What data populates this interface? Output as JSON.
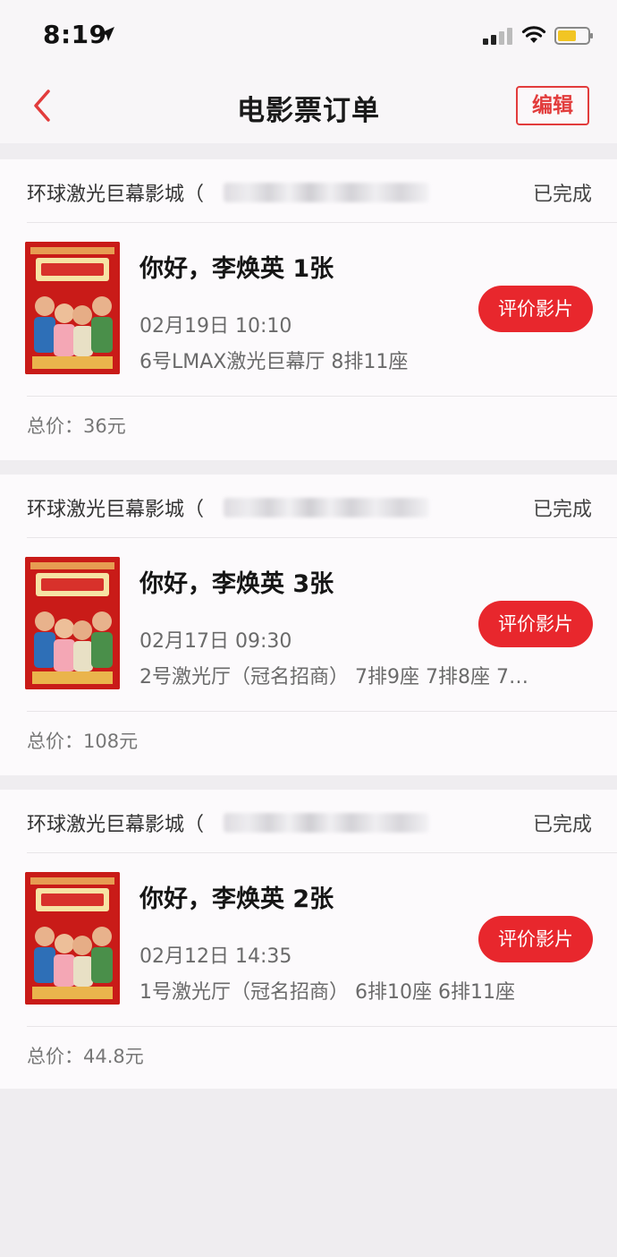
{
  "status_bar": {
    "time": "8:19"
  },
  "header": {
    "title": "电影票订单",
    "edit_label": "编辑"
  },
  "orders": [
    {
      "cinema": "环球激光巨幕影城（",
      "status": "已完成",
      "movie": "你好，李焕英 1张",
      "showtime": "02月19日 10:10",
      "seats": "6号LMAX激光巨幕厅 8排11座",
      "review_label": "评价影片",
      "total": "总价：36元"
    },
    {
      "cinema": "环球激光巨幕影城（",
      "status": "已完成",
      "movie": "你好，李焕英 3张",
      "showtime": "02月17日 09:30",
      "seats": "2号激光厅（冠名招商） 7排9座 7排8座 7…",
      "review_label": "评价影片",
      "total": "总价：108元"
    },
    {
      "cinema": "环球激光巨幕影城（",
      "status": "已完成",
      "movie": "你好，李焕英 2张",
      "showtime": "02月12日 14:35",
      "seats": "1号激光厅（冠名招商） 6排10座 6排11座",
      "review_label": "评价影片",
      "total": "总价：44.8元"
    }
  ],
  "colors": {
    "accent": "#e8272d",
    "background": "#efedf0",
    "card": "#fcfafc"
  }
}
